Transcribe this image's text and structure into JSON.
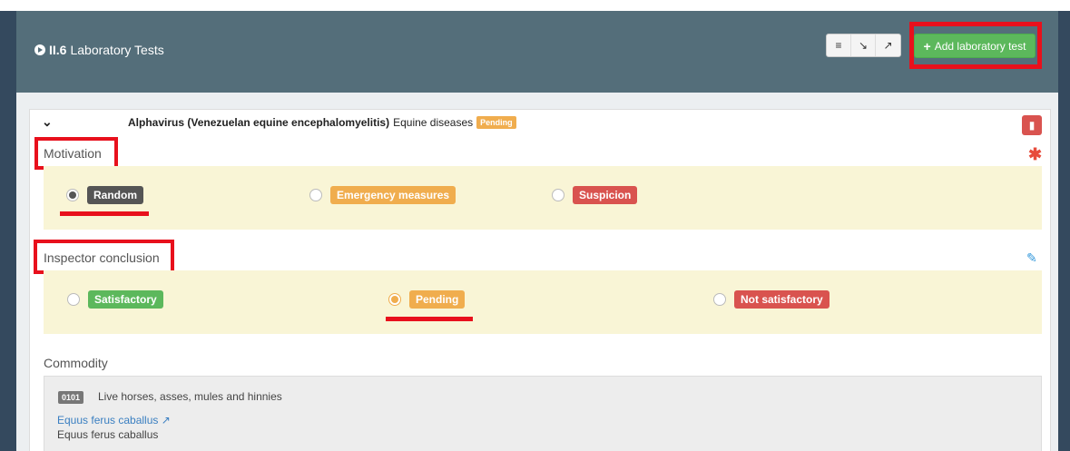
{
  "header": {
    "section_number": "II.6",
    "section_title": "Laboratory Tests",
    "view_buttons": [
      "list-icon",
      "collapse-icon",
      "expand-icon"
    ],
    "add_button_label": "Add laboratory test"
  },
  "test": {
    "name": "Alphavirus (Venezuelan equine encephalomyelitis)",
    "category": "Equine diseases",
    "status_badge": "Pending"
  },
  "motivation": {
    "label": "Motivation",
    "required_marker": "✱",
    "options": [
      {
        "label": "Random",
        "selected": true,
        "color": "#555555"
      },
      {
        "label": "Emergency measures",
        "selected": false,
        "color": "#f0ad4e"
      },
      {
        "label": "Suspicion",
        "selected": false,
        "color": "#d9534f"
      }
    ]
  },
  "conclusion": {
    "label": "Inspector conclusion",
    "options": [
      {
        "label": "Satisfactory",
        "selected": false,
        "color": "#5cb85c"
      },
      {
        "label": "Pending",
        "selected": true,
        "color": "#f0ad4e"
      },
      {
        "label": "Not satisfactory",
        "selected": false,
        "color": "#d9534f"
      }
    ]
  },
  "commodity": {
    "label": "Commodity",
    "code": "0101",
    "description": "Live horses, asses, mules and hinnies",
    "species_link": "Equus ferus caballus",
    "species_name": "Equus ferus caballus"
  },
  "colors": {
    "header_bg": "#546e7a",
    "highlight_red": "#e8101c",
    "band_bg": "#f9f5d6"
  }
}
